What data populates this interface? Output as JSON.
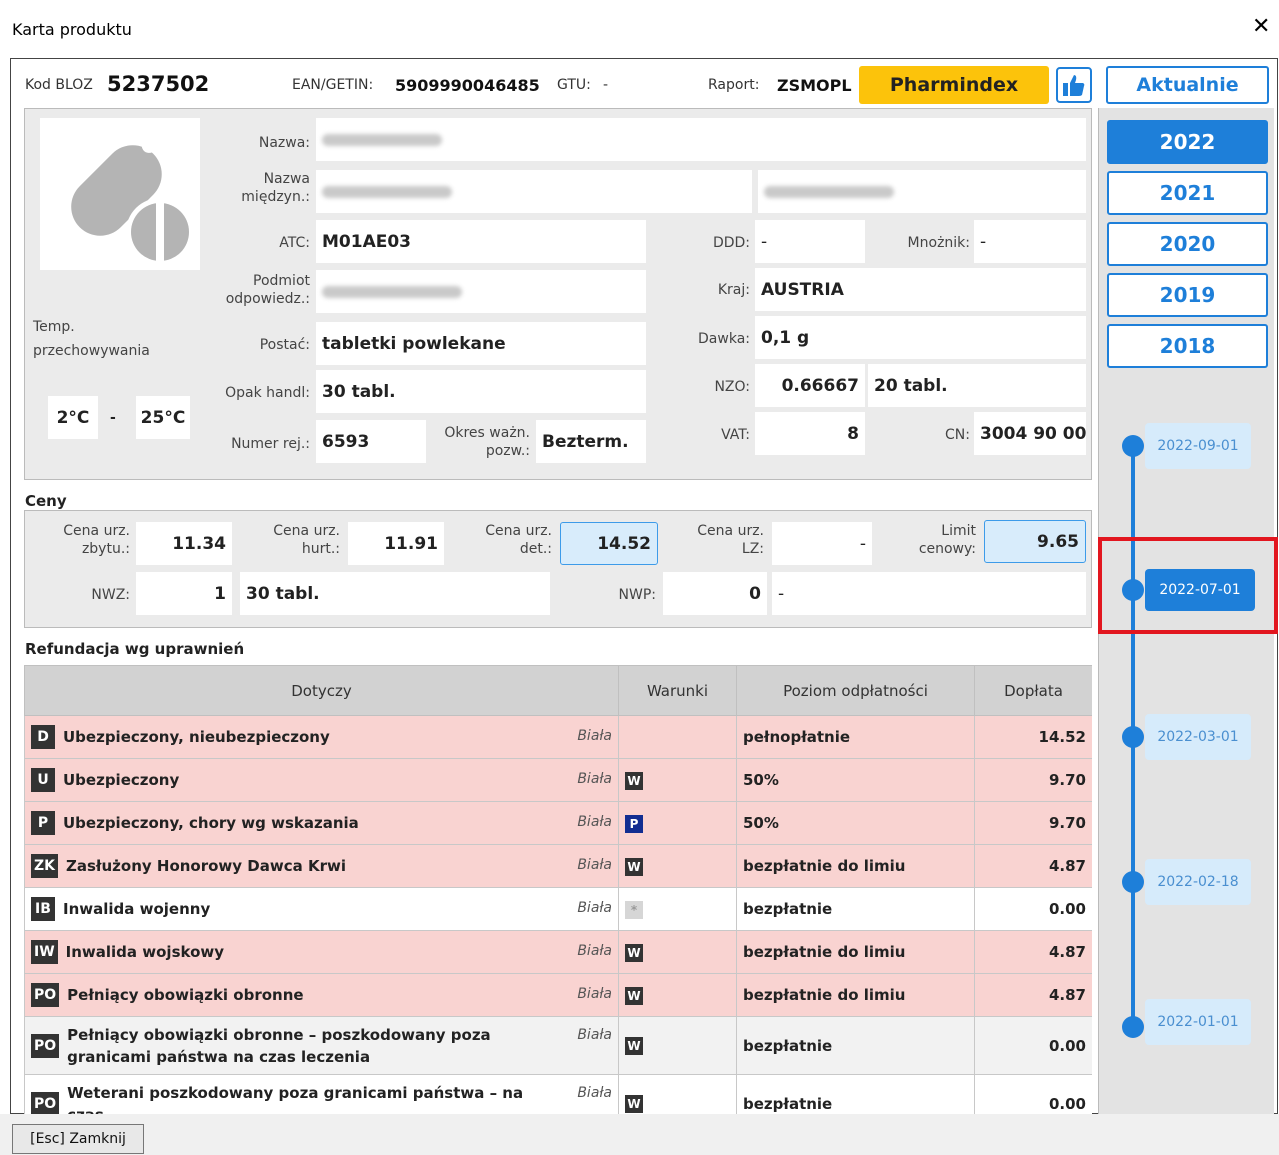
{
  "window": {
    "title": "Karta produktu"
  },
  "header": {
    "bloz_label": "Kod BLOZ",
    "bloz_value": "5237502",
    "ean_label": "EAN/GETIN:",
    "ean_value": "5909990046485",
    "gtu_label": "GTU:",
    "gtu_value": "-",
    "raport_label": "Raport:",
    "raport_value": "ZSMOPL",
    "pharmindex_label": "Pharmindex",
    "aktualnie_label": "Aktualnie"
  },
  "product": {
    "nazwa_label": "Nazwa:",
    "nazwa_miedzyn_label_1": "Nazwa",
    "nazwa_miedzyn_label_2": "międzyn.:",
    "atc_label": "ATC:",
    "atc_value": "M01AE03",
    "ddd_label": "DDD:",
    "ddd_value": "-",
    "mnoznik_label": "Mnożnik:",
    "mnoznik_value": "-",
    "podmiot_label_1": "Podmiot",
    "podmiot_label_2": "odpowiedz.:",
    "kraj_label": "Kraj:",
    "kraj_value": "AUSTRIA",
    "temp_label_1": "Temp.",
    "temp_label_2": "przechowywania",
    "postac_label": "Postać:",
    "postac_value": "tabletki powlekane",
    "dawka_label": "Dawka:",
    "dawka_value": "0,1 g",
    "opak_label": "Opak handl:",
    "opak_value": "30 tabl.",
    "nzo_label": "NZO:",
    "nzo_value": "0.66667",
    "nzo_unit": "20 tabl.",
    "temp_min": "2°C",
    "temp_sep": "-",
    "temp_max": "25°C",
    "numer_rej_label": "Numer rej.:",
    "numer_rej_value": "6593",
    "okres_label_1": "Okres ważn.",
    "okres_label_2": "pozw.:",
    "okres_value": "Bezterm.",
    "vat_label": "VAT:",
    "vat_value": "8",
    "cn_label": "CN:",
    "cn_value": "3004 90 00"
  },
  "prices": {
    "section_title": "Ceny",
    "cena_zbytu_label_1": "Cena urz.",
    "cena_zbytu_label_2": "zbytu.:",
    "cena_zbytu_value": "11.34",
    "cena_hurt_label_1": "Cena urz.",
    "cena_hurt_label_2": "hurt.:",
    "cena_hurt_value": "11.91",
    "cena_det_label_1": "Cena urz.",
    "cena_det_label_2": "det.:",
    "cena_det_value": "14.52",
    "cena_lz_label_1": "Cena urz.",
    "cena_lz_label_2": "LZ:",
    "cena_lz_value": "-",
    "limit_label_1": "Limit",
    "limit_label_2": "cenowy:",
    "limit_value": "9.65",
    "nwz_label": "NWZ:",
    "nwz_value": "1",
    "nwz_unit": "30 tabl.",
    "nwp_label": "NWP:",
    "nwp_value": "0",
    "nwp_unit": "-"
  },
  "refund": {
    "section_title": "Refundacja wg uprawnień",
    "columns": [
      "Dotyczy",
      "Warunki",
      "Poziom odpłatności",
      "Dopłata"
    ],
    "rows": [
      {
        "code": "D",
        "name": "Ubezpieczony, nieubezpieczony",
        "list": "Biała",
        "cond": "",
        "level": "pełnopłatnie",
        "doplata": "14.52"
      },
      {
        "code": "U",
        "name": "Ubezpieczony",
        "list": "Biała",
        "cond": "W",
        "level": "50%",
        "doplata": "9.70"
      },
      {
        "code": "P",
        "name": "Ubezpieczony, chory wg wskazania",
        "list": "Biała",
        "cond": "P",
        "level": "50%",
        "doplata": "9.70"
      },
      {
        "code": "ZK",
        "name": "Zasłużony Honorowy Dawca Krwi",
        "list": "Biała",
        "cond": "W",
        "level": "bezpłatnie do limiu",
        "doplata": "4.87"
      },
      {
        "code": "IB",
        "name": "Inwalida wojenny",
        "list": "Biała",
        "cond": "*",
        "level": "bezpłatnie",
        "doplata": "0.00"
      },
      {
        "code": "IW",
        "name": "Inwalida wojskowy",
        "list": "Biała",
        "cond": "W",
        "level": "bezpłatnie do limiu",
        "doplata": "4.87"
      },
      {
        "code": "PO",
        "name": "Pełniący obowiązki obronne",
        "list": "Biała",
        "cond": "W",
        "level": "bezpłatnie do limiu",
        "doplata": "4.87"
      },
      {
        "code": "PO",
        "name": "Pełniący obowiązki obronne – poszkodowany poza granicami państwa na czas leczenia",
        "list": "Biała",
        "cond": "W",
        "level": "bezpłatnie",
        "doplata": "0.00"
      },
      {
        "code": "PO",
        "name": "Weterani poszkodowany poza granicami państwa – na czas",
        "list": "Biała",
        "cond": "W",
        "level": "bezpłatnie",
        "doplata": "0.00"
      }
    ]
  },
  "years": [
    "2022",
    "2021",
    "2020",
    "2019",
    "2018"
  ],
  "timeline": [
    "2022-09-01",
    "2022-07-01",
    "2022-03-01",
    "2022-02-18",
    "2022-01-01"
  ],
  "footer": {
    "esc_label": "[Esc] Zamknij"
  },
  "colors": {
    "accent": "#1e7fd9",
    "pharmindex": "#fcc30b",
    "refund_row": "#f9d3d1",
    "highlight": "#e2161f"
  }
}
